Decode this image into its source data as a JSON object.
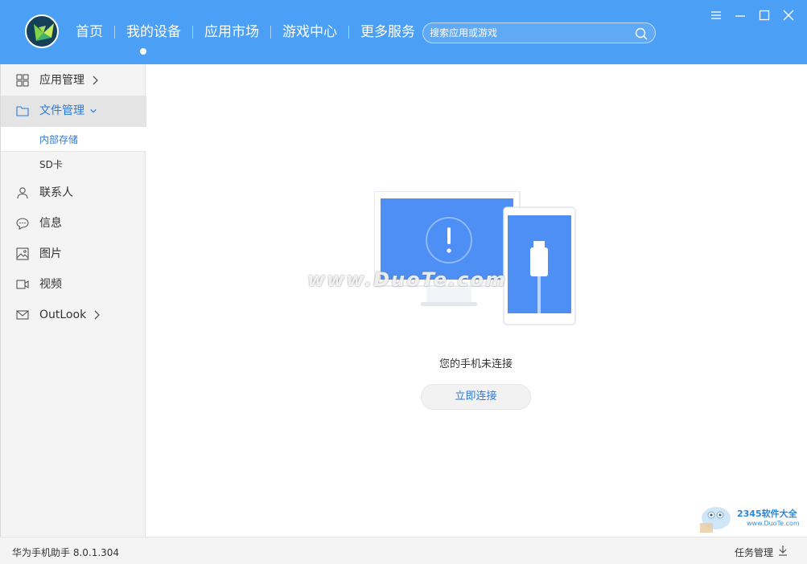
{
  "nav": {
    "items": [
      "首页",
      "我的设备",
      "应用市场",
      "游戏中心",
      "更多服务"
    ],
    "active_index": 1
  },
  "search": {
    "placeholder": "搜索应用或游戏"
  },
  "sidebar": {
    "items": [
      {
        "label": "应用管理",
        "icon": "grid-icon"
      },
      {
        "label": "文件管理",
        "icon": "folder-icon"
      },
      {
        "label": "联系人",
        "icon": "person-icon"
      },
      {
        "label": "信息",
        "icon": "message-icon"
      },
      {
        "label": "图片",
        "icon": "image-icon"
      },
      {
        "label": "视频",
        "icon": "video-icon"
      },
      {
        "label": "OutLook",
        "icon": "mail-icon"
      }
    ],
    "sub_items": [
      "内部存储",
      "SD卡"
    ]
  },
  "main": {
    "watermark": "www.DuoTe.com",
    "status": "您的手机未连接",
    "connect_button": "立即连接"
  },
  "footer": {
    "version": "华为手机助手 8.0.1.304",
    "task_manager": "任务管理"
  },
  "badge": {
    "title": "2345软件大全",
    "url": "www.DuoTe.com"
  },
  "colors": {
    "header": "#4b9ff4",
    "accent": "#2a7bd8",
    "screen": "#4d8ff5"
  }
}
